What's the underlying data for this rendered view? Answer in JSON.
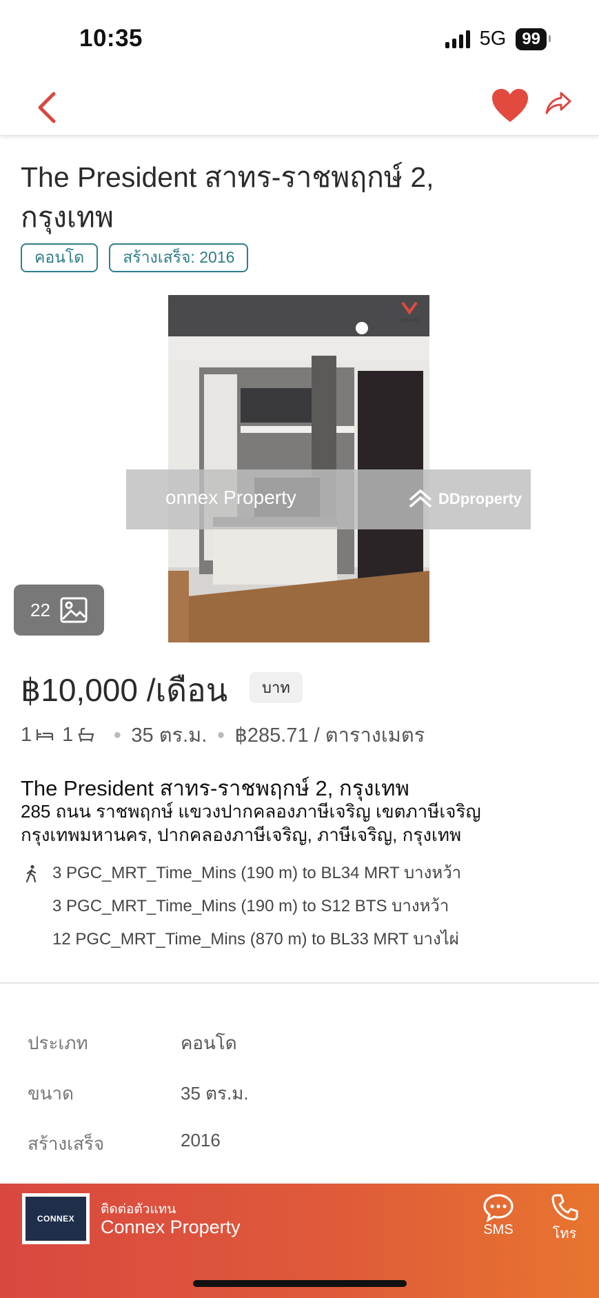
{
  "status_bar": {
    "time": "10:35",
    "network": "5G",
    "battery": "99"
  },
  "listing": {
    "title": "The President สาทร-ราชพฤกษ์ 2, กรุงเทพ",
    "tags": [
      "คอนโด",
      "สร้างเสร็จ: 2016"
    ],
    "photo_count": "22",
    "watermark_left": "onnex Property",
    "watermark_right": "DDproperty",
    "photo_logo_text": "CONNEX",
    "price": "฿10,000 /เดือน",
    "currency_chip": "บาท",
    "beds": "1",
    "baths": "1",
    "area": "35 ตร.ม.",
    "price_per_sqm": "฿285.71 / ตารางเมตร",
    "project_name": "The President สาทร-ราชพฤกษ์ 2, กรุงเทพ",
    "address_line1": "285 ถนน ราชพฤกษ์ แขวงปากคลองภาษีเจริญ เขตภาษีเจริญ",
    "address_line2": "กรุงเทพมหานคร, ปากคลองภาษีเจริญ, ภาษีเจริญ, กรุงเทพ",
    "transit": [
      "3 PGC_MRT_Time_Mins (190 m) to BL34 MRT บางหว้า",
      "3 PGC_MRT_Time_Mins (190 m) to S12 BTS บางหว้า",
      "12 PGC_MRT_Time_Mins (870 m) to BL33 MRT บางไผ่"
    ]
  },
  "details": [
    {
      "label": "ประเภท",
      "value": "คอนโด"
    },
    {
      "label": "ขนาด",
      "value": "35 ตร.ม."
    },
    {
      "label": "สร้างเสร็จ",
      "value": "2016"
    }
  ],
  "agent": {
    "label": "ติดต่อตัวแทน",
    "name": "Connex Property",
    "logo_text": "CONNEX",
    "sms_label": "SMS",
    "call_label": "โทร"
  },
  "colors": {
    "accent": "#d94840",
    "tag": "#2e7d86",
    "heart": "#e24a3f"
  },
  "icons": [
    "back-chevron-icon",
    "heart-icon",
    "share-icon",
    "gallery-icon",
    "bed-icon",
    "bath-icon",
    "walk-icon",
    "sms-icon",
    "phone-icon"
  ]
}
